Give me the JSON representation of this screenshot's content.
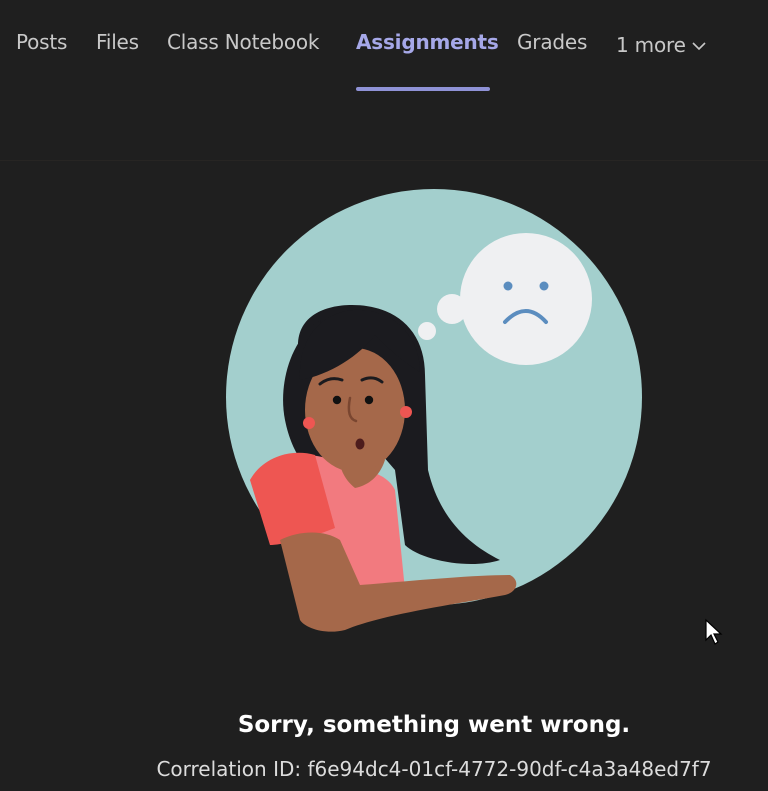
{
  "tabs": [
    {
      "label": "Posts",
      "active": false
    },
    {
      "label": "Files",
      "active": false
    },
    {
      "label": "Class Notebook",
      "active": false
    },
    {
      "label": "Assignments",
      "active": true
    },
    {
      "label": "Grades",
      "active": false
    },
    {
      "label": "1 more",
      "active": false
    }
  ],
  "error": {
    "title": "Sorry, something went wrong.",
    "correlation": "Correlation ID: f6e94dc4-01cf-4772-90df-c4a3a48ed7f7"
  },
  "icons": {
    "more_chevron": "chevron-down-icon",
    "cursor": "mouse-pointer-icon"
  },
  "colors": {
    "background": "#1f1f1f",
    "active_tab": "#a6a8e8",
    "tab_underline": "#8f92d6",
    "illustration_circle": "#a3cfcd"
  }
}
